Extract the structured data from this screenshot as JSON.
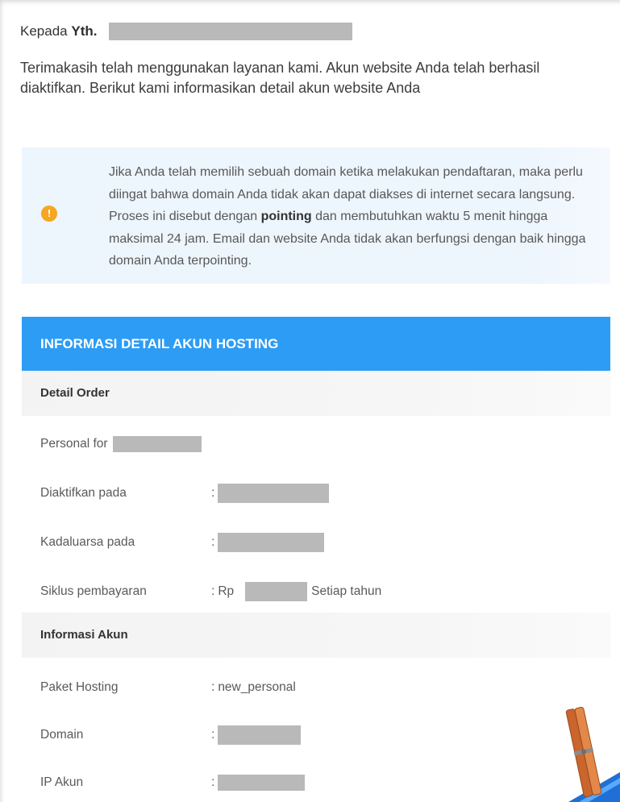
{
  "colors": {
    "header_blue": "#2d9cf4",
    "notice_background": "#edf5fd",
    "warning_orange": "#f5a623",
    "redaction_gray": "#b9b9b9"
  },
  "greeting": {
    "salutation": "Kepada",
    "honorific": "Yth."
  },
  "intro": "Terimakasih telah menggunakan layanan kami. Akun website Anda telah berhasil diaktifkan. Berikut kami informasikan detail akun website Anda",
  "notice": {
    "icon": "warning-icon",
    "icon_symbol": "!",
    "lines": [
      {
        "text": "Jika Anda telah memilih sebuah domain ketika melakukan pendaftaran, maka perlu"
      },
      {
        "text": "diingat bahwa domain Anda tidak akan dapat diakses di internet secara langsung."
      },
      {
        "text": "Proses ini disebut dengan ",
        "bold": "pointing",
        "after": " dan membutuhkan waktu 5 menit hingga"
      },
      {
        "text": "maksimal 24 jam. Email dan website Anda tidak akan berfungsi dengan baik hingga"
      },
      {
        "text": "domain Anda terpointing."
      }
    ]
  },
  "account_details": {
    "title": "INFORMASI DETAIL AKUN HOSTING",
    "separator": ":",
    "order": {
      "heading": "Detail Order",
      "plan_label": "Personal for",
      "rows": [
        {
          "label": "Diaktifkan pada"
        },
        {
          "label": "Kadaluarsa pada"
        },
        {
          "label": "Siklus pembayaran",
          "currency": "Rp",
          "period": "Setiap tahun"
        }
      ]
    },
    "account": {
      "heading": "Informasi Akun",
      "rows": [
        {
          "label": "Paket Hosting",
          "value": "new_personal"
        },
        {
          "label": "Domain"
        },
        {
          "label": "IP Akun"
        }
      ]
    }
  },
  "decoration_icon": "clothespin-icon"
}
